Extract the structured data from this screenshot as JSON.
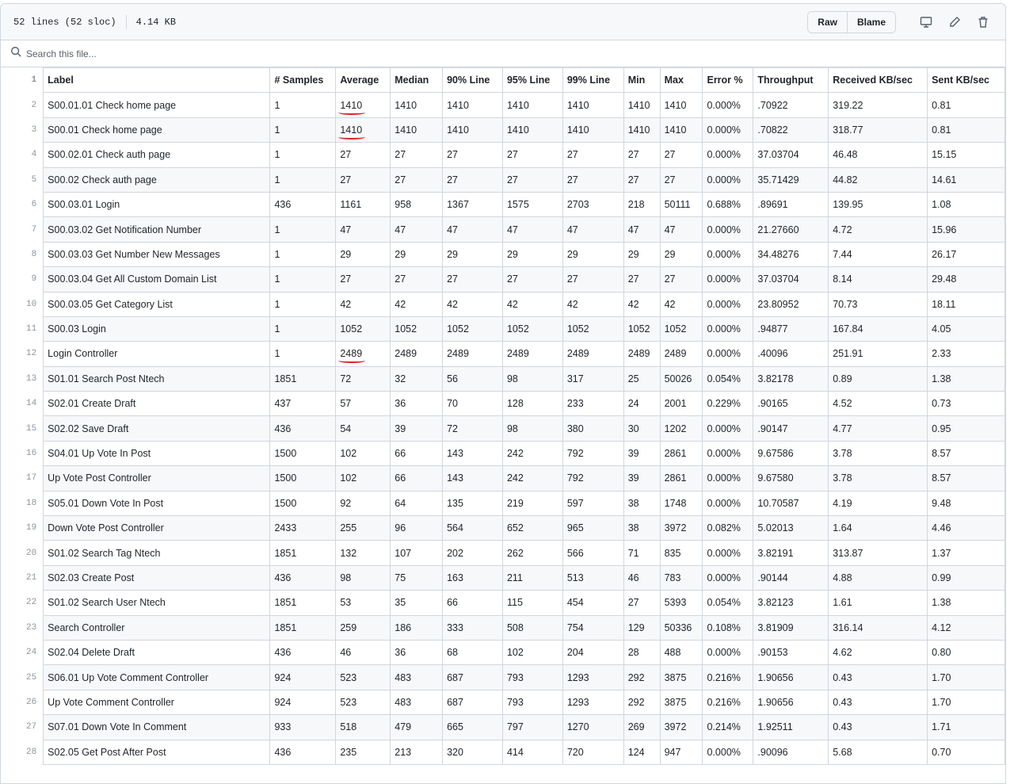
{
  "file": {
    "lines": "52 lines (52 sloc)",
    "size": "4.14 KB"
  },
  "toolbar": {
    "raw_label": "Raw",
    "blame_label": "Blame"
  },
  "search": {
    "placeholder": "Search this file..."
  },
  "table": {
    "headers": [
      "Label",
      "# Samples",
      "Average",
      "Median",
      "90% Line",
      "95% Line",
      "99% Line",
      "Min",
      "Max",
      "Error %",
      "Throughput",
      "Received KB/sec",
      "Sent KB/sec"
    ],
    "rows": [
      [
        "S00.01.01 Check home page",
        "1",
        "1410",
        "1410",
        "1410",
        "1410",
        "1410",
        "1410",
        "1410",
        "0.000%",
        ".70922",
        "319.22",
        "0.81"
      ],
      [
        "S00.01 Check home page",
        "1",
        "1410",
        "1410",
        "1410",
        "1410",
        "1410",
        "1410",
        "1410",
        "0.000%",
        ".70822",
        "318.77",
        "0.81"
      ],
      [
        "S00.02.01 Check auth page",
        "1",
        "27",
        "27",
        "27",
        "27",
        "27",
        "27",
        "27",
        "0.000%",
        "37.03704",
        "46.48",
        "15.15"
      ],
      [
        "S00.02 Check auth page",
        "1",
        "27",
        "27",
        "27",
        "27",
        "27",
        "27",
        "27",
        "0.000%",
        "35.71429",
        "44.82",
        "14.61"
      ],
      [
        "S00.03.01 Login",
        "436",
        "1161",
        "958",
        "1367",
        "1575",
        "2703",
        "218",
        "50111",
        "0.688%",
        ".89691",
        "139.95",
        "1.08"
      ],
      [
        "S00.03.02 Get Notification Number",
        "1",
        "47",
        "47",
        "47",
        "47",
        "47",
        "47",
        "47",
        "0.000%",
        "21.27660",
        "4.72",
        "15.96"
      ],
      [
        "S00.03.03 Get Number New Messages",
        "1",
        "29",
        "29",
        "29",
        "29",
        "29",
        "29",
        "29",
        "0.000%",
        "34.48276",
        "7.44",
        "26.17"
      ],
      [
        "S00.03.04 Get All Custom Domain List",
        "1",
        "27",
        "27",
        "27",
        "27",
        "27",
        "27",
        "27",
        "0.000%",
        "37.03704",
        "8.14",
        "29.48"
      ],
      [
        "S00.03.05 Get Category List",
        "1",
        "42",
        "42",
        "42",
        "42",
        "42",
        "42",
        "42",
        "0.000%",
        "23.80952",
        "70.73",
        "18.11"
      ],
      [
        "S00.03 Login",
        "1",
        "1052",
        "1052",
        "1052",
        "1052",
        "1052",
        "1052",
        "1052",
        "0.000%",
        ".94877",
        "167.84",
        "4.05"
      ],
      [
        "Login Controller",
        "1",
        "2489",
        "2489",
        "2489",
        "2489",
        "2489",
        "2489",
        "2489",
        "0.000%",
        ".40096",
        "251.91",
        "2.33"
      ],
      [
        "S01.01 Search Post Ntech",
        "1851",
        "72",
        "32",
        "56",
        "98",
        "317",
        "25",
        "50026",
        "0.054%",
        "3.82178",
        "0.89",
        "1.38"
      ],
      [
        "S02.01 Create Draft",
        "437",
        "57",
        "36",
        "70",
        "128",
        "233",
        "24",
        "2001",
        "0.229%",
        ".90165",
        "4.52",
        "0.73"
      ],
      [
        "S02.02 Save Draft",
        "436",
        "54",
        "39",
        "72",
        "98",
        "380",
        "30",
        "1202",
        "0.000%",
        ".90147",
        "4.77",
        "0.95"
      ],
      [
        "S04.01 Up Vote In Post",
        "1500",
        "102",
        "66",
        "143",
        "242",
        "792",
        "39",
        "2861",
        "0.000%",
        "9.67586",
        "3.78",
        "8.57"
      ],
      [
        "Up Vote Post Controller",
        "1500",
        "102",
        "66",
        "143",
        "242",
        "792",
        "39",
        "2861",
        "0.000%",
        "9.67580",
        "3.78",
        "8.57"
      ],
      [
        "S05.01 Down Vote In Post",
        "1500",
        "92",
        "64",
        "135",
        "219",
        "597",
        "38",
        "1748",
        "0.000%",
        "10.70587",
        "4.19",
        "9.48"
      ],
      [
        "Down Vote Post Controller",
        "2433",
        "255",
        "96",
        "564",
        "652",
        "965",
        "38",
        "3972",
        "0.082%",
        "5.02013",
        "1.64",
        "4.46"
      ],
      [
        "S01.02 Search Tag Ntech",
        "1851",
        "132",
        "107",
        "202",
        "262",
        "566",
        "71",
        "835",
        "0.000%",
        "3.82191",
        "313.87",
        "1.37"
      ],
      [
        "S02.03 Create Post",
        "436",
        "98",
        "75",
        "163",
        "211",
        "513",
        "46",
        "783",
        "0.000%",
        ".90144",
        "4.88",
        "0.99"
      ],
      [
        "S01.02 Search User Ntech",
        "1851",
        "53",
        "35",
        "66",
        "115",
        "454",
        "27",
        "5393",
        "0.054%",
        "3.82123",
        "1.61",
        "1.38"
      ],
      [
        "Search Controller",
        "1851",
        "259",
        "186",
        "333",
        "508",
        "754",
        "129",
        "50336",
        "0.108%",
        "3.81909",
        "316.14",
        "4.12"
      ],
      [
        "S02.04 Delete Draft",
        "436",
        "46",
        "36",
        "68",
        "102",
        "204",
        "28",
        "488",
        "0.000%",
        ".90153",
        "4.62",
        "0.80"
      ],
      [
        "S06.01 Up Vote Comment Controller",
        "924",
        "523",
        "483",
        "687",
        "793",
        "1293",
        "292",
        "3875",
        "0.216%",
        "1.90656",
        "0.43",
        "1.70"
      ],
      [
        "Up Vote Comment Controller",
        "924",
        "523",
        "483",
        "687",
        "793",
        "1293",
        "292",
        "3875",
        "0.216%",
        "1.90656",
        "0.43",
        "1.70"
      ],
      [
        "S07.01 Down Vote In Comment",
        "933",
        "518",
        "479",
        "665",
        "797",
        "1270",
        "269",
        "3972",
        "0.214%",
        "1.92511",
        "0.43",
        "1.71"
      ],
      [
        "S02.05 Get Post After Post",
        "436",
        "235",
        "213",
        "320",
        "414",
        "720",
        "124",
        "947",
        "0.000%",
        ".90096",
        "5.68",
        "0.70"
      ]
    ]
  }
}
